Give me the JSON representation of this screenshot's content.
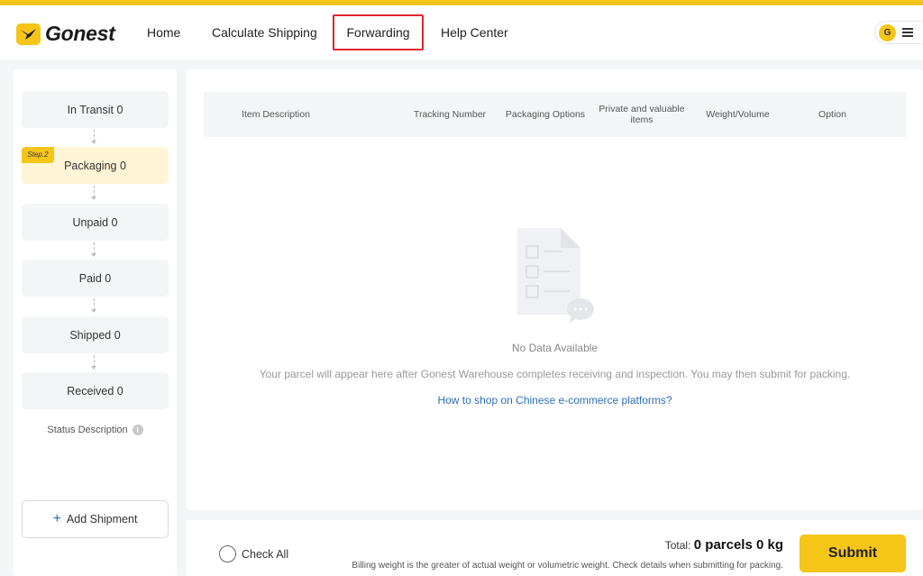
{
  "header": {
    "logo_text": "Gonest",
    "nav": [
      {
        "label": "Home"
      },
      {
        "label": "Calculate Shipping"
      },
      {
        "label": "Forwarding"
      },
      {
        "label": "Help Center"
      }
    ],
    "active_nav": "Forwarding",
    "avatar_initial": "G"
  },
  "sidebar": {
    "steps": [
      {
        "label": "In Transit 0"
      },
      {
        "label": "Packaging 0",
        "tag": "Step.2"
      },
      {
        "label": "Unpaid 0"
      },
      {
        "label": "Paid 0"
      },
      {
        "label": "Shipped 0"
      },
      {
        "label": "Received 0"
      }
    ],
    "status_description": "Status Description",
    "add_shipment": "Add Shipment"
  },
  "table": {
    "columns": [
      "Item Description",
      "Tracking Number",
      "Packaging Options",
      "Private and valuable items",
      "Weight/Volume",
      "Option"
    ]
  },
  "empty_state": {
    "title": "No Data Available",
    "description": "Your parcel will appear here after Gonest Warehouse completes receiving and inspection. You may then submit for packing.",
    "link": "How to shop on Chinese e-commerce platforms?"
  },
  "footer": {
    "check_all": "Check All",
    "total_label": "Total:",
    "total_value": "0 parcels 0 kg",
    "billing_note": "Billing weight is the greater of actual weight or volumetric weight. Check details when submitting for packing.",
    "submit": "Submit"
  },
  "colors": {
    "brand_yellow": "#f5c518",
    "active_outline": "#e0242f",
    "link_blue": "#2d6fb8",
    "active_step_bg": "#fff4d6"
  }
}
